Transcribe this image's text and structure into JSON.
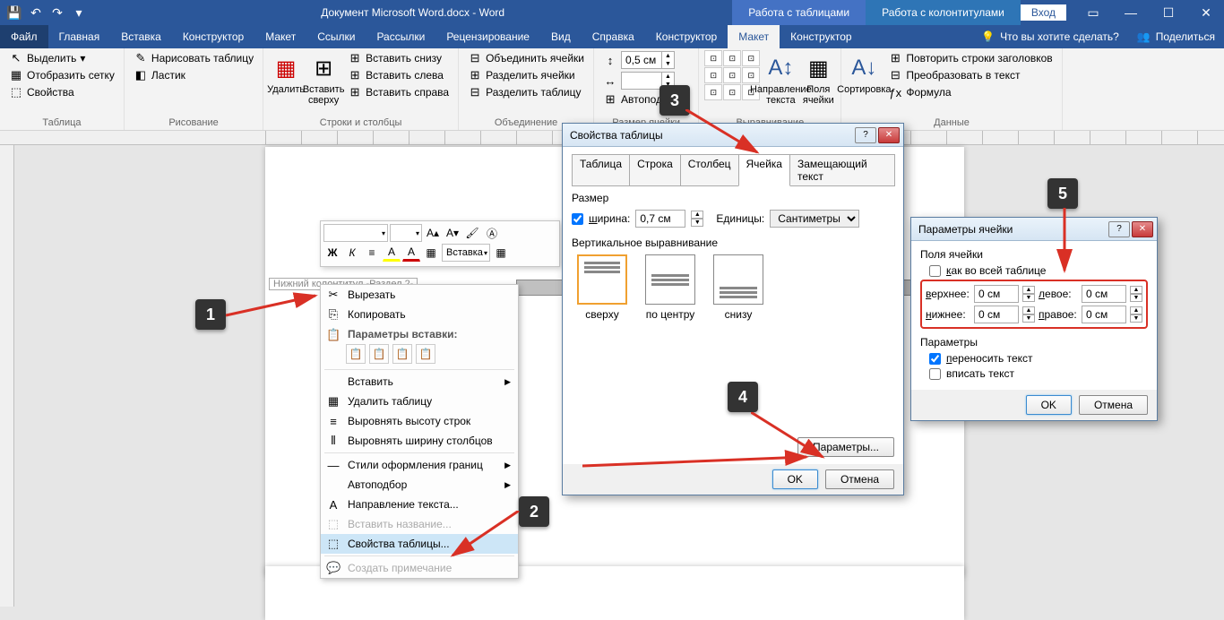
{
  "title": "Документ Microsoft Word.docx - Word",
  "context_tabs": {
    "tables": "Работа с таблицами",
    "headers": "Работа с колонтитулами"
  },
  "login": "Вход",
  "menu": {
    "file": "Файл",
    "home": "Главная",
    "insert": "Вставка",
    "constructor": "Конструктор",
    "layout": "Макет",
    "links": "Ссылки",
    "mailings": "Рассылки",
    "review": "Рецензирование",
    "view": "Вид",
    "help": "Справка",
    "table_constructor": "Конструктор",
    "table_layout": "Макет",
    "hf_constructor": "Конструктор",
    "tell_me": "Что вы хотите сделать?",
    "share": "Поделиться"
  },
  "ribbon": {
    "g_table": "Таблица",
    "select": "Выделить",
    "gridlines": "Отобразить сетку",
    "props": "Свойства",
    "g_draw": "Рисование",
    "draw": "Нарисовать таблицу",
    "eraser": "Ластик",
    "g_rowscols": "Строки и столбцы",
    "delete": "Удалить",
    "ins_top": "Вставить сверху",
    "ins_bottom": "Вставить снизу",
    "ins_left": "Вставить слева",
    "ins_right": "Вставить справа",
    "g_merge": "Объединение",
    "merge": "Объединить ячейки",
    "split": "Разделить ячейки",
    "split_tbl": "Разделить таблицу",
    "g_cellsize": "Размер ячейки",
    "height": "0,5 см",
    "width": "",
    "autofit": "Автоподбор",
    "g_align": "Выравнивание",
    "textdir": "Направление текста",
    "margins": "Поля ячейки",
    "g_data": "Данные",
    "sort": "Сортировка",
    "repeat_hdr": "Повторить строки заголовков",
    "convert": "Преобразовать в текст",
    "formula": "Формула"
  },
  "footer_section": "Нижний колонтитул -Раздел 2-",
  "minitb": {
    "insert": "Вставка",
    "bold": "Ж",
    "italic": "К"
  },
  "ctxmenu": {
    "cut": "Вырезать",
    "copy": "Копировать",
    "paste_opts": "Параметры вставки:",
    "insert": "Вставить",
    "delete_tbl": "Удалить таблицу",
    "dist_rows": "Выровнять высоту строк",
    "dist_cols": "Выровнять ширину столбцов",
    "border_styles": "Стили оформления границ",
    "autofit": "Автоподбор",
    "textdir": "Направление текста...",
    "caption": "Вставить название...",
    "tbl_props": "Свойства таблицы...",
    "comment": "Создать примечание"
  },
  "dlg1": {
    "title": "Свойства таблицы",
    "tabs": {
      "table": "Таблица",
      "row": "Строка",
      "col": "Столбец",
      "cell": "Ячейка",
      "alt": "Замещающий текст"
    },
    "size": "Размер",
    "width": "ширина:",
    "width_val": "0,7 см",
    "units": "Единицы:",
    "units_val": "Сантиметры",
    "valign": "Вертикальное выравнивание",
    "top": "сверху",
    "center": "по центру",
    "bottom": "снизу",
    "options": "Параметры...",
    "ok": "OK",
    "cancel": "Отмена"
  },
  "dlg2": {
    "title": "Параметры ячейки",
    "margins": "Поля ячейки",
    "same": "как во всей таблице",
    "top": "верхнее:",
    "bottom": "нижнее:",
    "left": "левое:",
    "right": "правое:",
    "val": "0 см",
    "params": "Параметры",
    "wrap": "переносить текст",
    "fit": "вписать текст",
    "ok": "OK",
    "cancel": "Отмена"
  },
  "callouts": {
    "1": "1",
    "2": "2",
    "3": "3",
    "4": "4",
    "5": "5"
  }
}
